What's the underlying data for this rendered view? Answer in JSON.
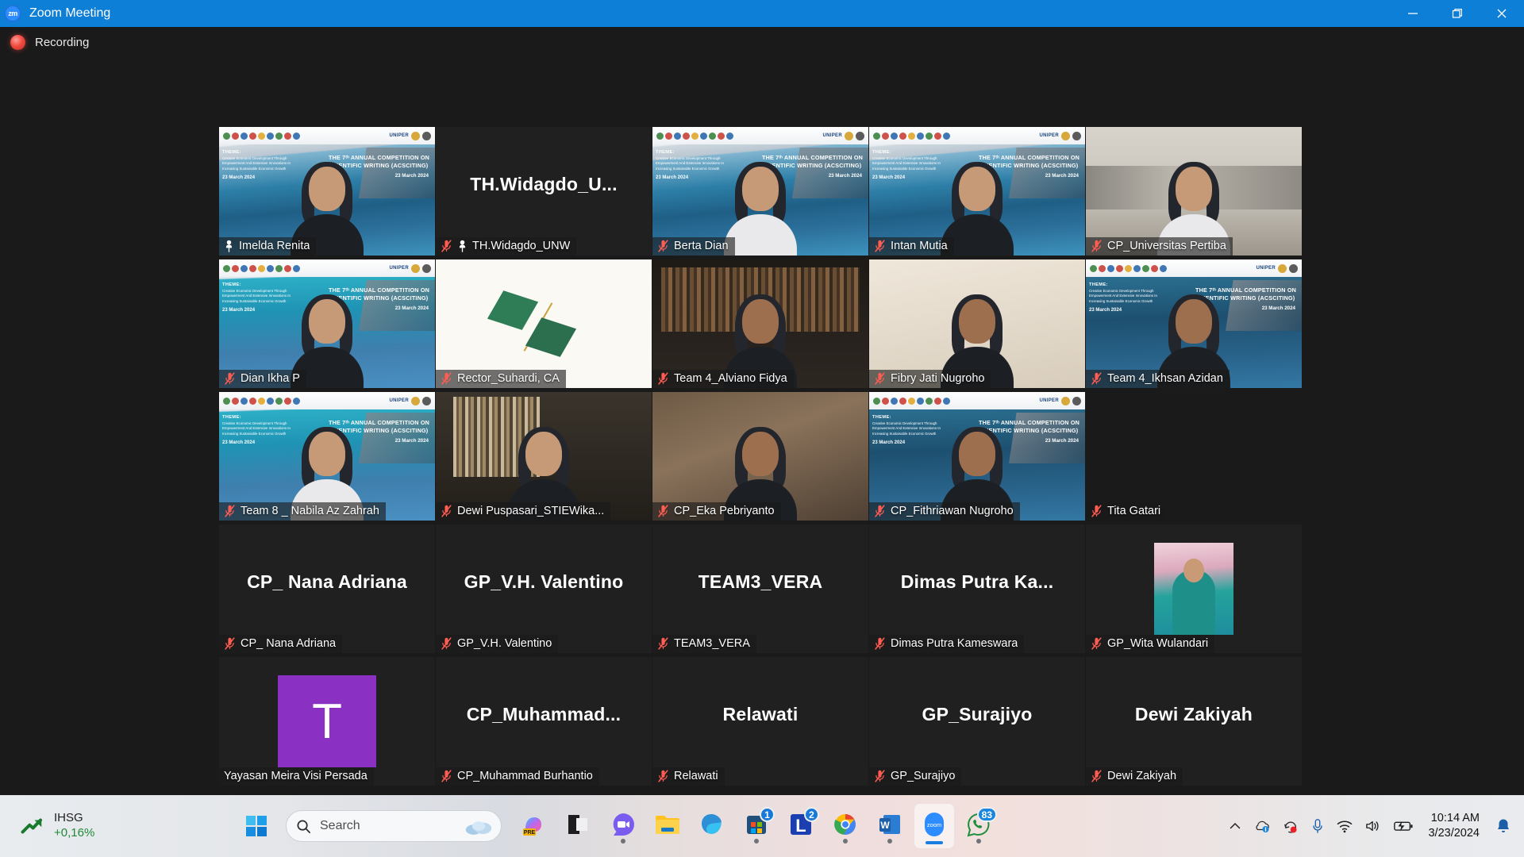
{
  "window": {
    "title": "Zoom Meeting",
    "app_logo_text": "zm",
    "minimize_label": "Minimize",
    "restore_label": "Restore",
    "close_label": "Close"
  },
  "recording": {
    "label": "Recording"
  },
  "gallery": {
    "participants": [
      {
        "name": "Imelda Renita",
        "muted": false,
        "pinned": true,
        "speaking": true,
        "video": true,
        "visual": "vbg-hijab",
        "big_name": ""
      },
      {
        "name": "TH.Widagdo_UNW",
        "muted": true,
        "pinned": true,
        "speaking": false,
        "video": false,
        "visual": "none",
        "big_name": "TH.Widagdo_U..."
      },
      {
        "name": "Berta Dian",
        "muted": true,
        "pinned": false,
        "speaking": false,
        "video": true,
        "visual": "vbg-person",
        "big_name": ""
      },
      {
        "name": "Intan Mutia",
        "muted": true,
        "pinned": false,
        "speaking": false,
        "video": true,
        "visual": "vbg-person2",
        "big_name": ""
      },
      {
        "name": "CP_Universitas Pertiba",
        "muted": true,
        "pinned": false,
        "speaking": false,
        "video": true,
        "visual": "room-office",
        "big_name": ""
      },
      {
        "name": "Dian Ikha P",
        "muted": true,
        "pinned": false,
        "speaking": false,
        "video": true,
        "visual": "vbg-teal",
        "big_name": ""
      },
      {
        "name": "Rector_Suhardi, CA",
        "muted": true,
        "pinned": false,
        "speaking": false,
        "video": true,
        "visual": "slide-diamond",
        "big_name": ""
      },
      {
        "name": "Team 4_Alviano Fidya",
        "muted": true,
        "pinned": false,
        "speaking": false,
        "video": true,
        "visual": "room-books",
        "big_name": ""
      },
      {
        "name": "Fibry Jati Nugroho",
        "muted": true,
        "pinned": false,
        "speaking": false,
        "video": true,
        "visual": "room-plain",
        "big_name": ""
      },
      {
        "name": "Team 4_Ikhsan Azidan",
        "muted": true,
        "pinned": false,
        "speaking": false,
        "video": true,
        "visual": "vbg-dark",
        "big_name": ""
      },
      {
        "name": "Team 8 _ Nabila Az Zahrah",
        "muted": true,
        "pinned": false,
        "speaking": false,
        "video": true,
        "visual": "vbg-teal2",
        "big_name": ""
      },
      {
        "name": "Dewi Puspasari_STIEWika...",
        "muted": true,
        "pinned": false,
        "speaking": false,
        "video": true,
        "visual": "room-books2",
        "big_name": ""
      },
      {
        "name": "CP_Eka Pebriyanto",
        "muted": true,
        "pinned": false,
        "speaking": false,
        "video": true,
        "visual": "room-home",
        "big_name": ""
      },
      {
        "name": "CP_Fithriawan Nugroho",
        "muted": true,
        "pinned": false,
        "speaking": false,
        "video": true,
        "visual": "vbg-dark2",
        "big_name": ""
      },
      {
        "name": "Tita Gatari",
        "muted": true,
        "pinned": false,
        "speaking": false,
        "video": false,
        "visual": "none",
        "big_name": ""
      },
      {
        "name": "CP_ Nana Adriana",
        "muted": true,
        "pinned": false,
        "speaking": false,
        "video": false,
        "visual": "none",
        "big_name": "CP_ Nana Adriana"
      },
      {
        "name": "GP_V.H. Valentino",
        "muted": true,
        "pinned": false,
        "speaking": false,
        "video": false,
        "visual": "none",
        "big_name": "GP_V.H. Valentino"
      },
      {
        "name": "TEAM3_VERA",
        "muted": true,
        "pinned": false,
        "speaking": false,
        "video": false,
        "visual": "none",
        "big_name": "TEAM3_VERA"
      },
      {
        "name": "Dimas Putra Kameswara",
        "muted": true,
        "pinned": false,
        "speaking": false,
        "video": false,
        "visual": "none",
        "big_name": "Dimas  Putra  Ka..."
      },
      {
        "name": "GP_Wita Wulandari",
        "muted": true,
        "pinned": false,
        "speaking": false,
        "video": false,
        "visual": "avatar-photo",
        "big_name": ""
      },
      {
        "name": "Yayasan Meira Visi Persada",
        "muted": false,
        "pinned": false,
        "speaking": false,
        "video": false,
        "visual": "avatar-letter",
        "avatar_letter": "T",
        "big_name": ""
      },
      {
        "name": "CP_Muhammad Burhantio",
        "muted": true,
        "pinned": false,
        "speaking": false,
        "video": false,
        "visual": "none",
        "big_name": "CP_Muhammad..."
      },
      {
        "name": "Relawati",
        "muted": true,
        "pinned": false,
        "speaking": false,
        "video": false,
        "visual": "none",
        "big_name": "Relawati"
      },
      {
        "name": "GP_Surajiyo",
        "muted": true,
        "pinned": false,
        "speaking": false,
        "video": false,
        "visual": "none",
        "big_name": "GP_Surajiyo"
      },
      {
        "name": "Dewi Zakiyah",
        "muted": true,
        "pinned": false,
        "speaking": false,
        "video": false,
        "visual": "none",
        "big_name": "Dewi Zakiyah"
      }
    ],
    "virtual_background": {
      "theme_heading": "THEME:",
      "theme_body": "Creative Economic Development Through Empowerment And Extensive Innovations In Increasing Sustainable Economic Growth",
      "event_date": "23 March 2024",
      "event_title": "THE 7ᵗʰ ANNUAL COMPETITION ON SCIENTIFIC WRITING (ACSCITING)",
      "university": "UNIPER"
    },
    "accent_speaking_color": "#e9ef5a",
    "mute_icon_color": "#ff5c52"
  },
  "taskbar": {
    "stock": {
      "name": "IHSG",
      "change": "+0,16%",
      "icon": "stock-up-icon"
    },
    "start_label": "Start",
    "search": {
      "placeholder": "Search",
      "icon": "search-icon",
      "weather_icon": "cloud-icon"
    },
    "apps": [
      {
        "name": "copilot-pre",
        "label": "PRE",
        "badge": "",
        "running": false
      },
      {
        "name": "lark-black",
        "label": "",
        "badge": "",
        "running": false
      },
      {
        "name": "zoom-purple-chat",
        "label": "",
        "badge": "",
        "running": true
      },
      {
        "name": "file-explorer",
        "label": "",
        "badge": "",
        "running": false
      },
      {
        "name": "microsoft-edge",
        "label": "",
        "badge": "",
        "running": false
      },
      {
        "name": "microsoft-store",
        "label": "",
        "badge": "1",
        "running": true
      },
      {
        "name": "lark-suite",
        "label": "L",
        "badge": "2",
        "running": false
      },
      {
        "name": "google-chrome",
        "label": "",
        "badge": "",
        "running": true
      },
      {
        "name": "microsoft-word",
        "label": "W",
        "badge": "",
        "running": true
      },
      {
        "name": "zoom",
        "label": "zoom",
        "badge": "",
        "running": true,
        "active": true
      },
      {
        "name": "whatsapp",
        "label": "",
        "badge": "83",
        "running": true
      }
    ],
    "tray": [
      {
        "name": "show-hidden-icons",
        "icon": "chevron-up-icon"
      },
      {
        "name": "onedrive",
        "icon": "cloud-info-icon"
      },
      {
        "name": "screen-recorder",
        "icon": "record-icon"
      },
      {
        "name": "microphone",
        "icon": "microphone-icon"
      },
      {
        "name": "network",
        "icon": "wifi-icon"
      },
      {
        "name": "volume",
        "icon": "speaker-icon"
      },
      {
        "name": "battery",
        "icon": "battery-charging-icon"
      }
    ],
    "clock": {
      "time": "10:14 AM",
      "date": "3/23/2024"
    },
    "notifications_icon": "bell-icon"
  }
}
